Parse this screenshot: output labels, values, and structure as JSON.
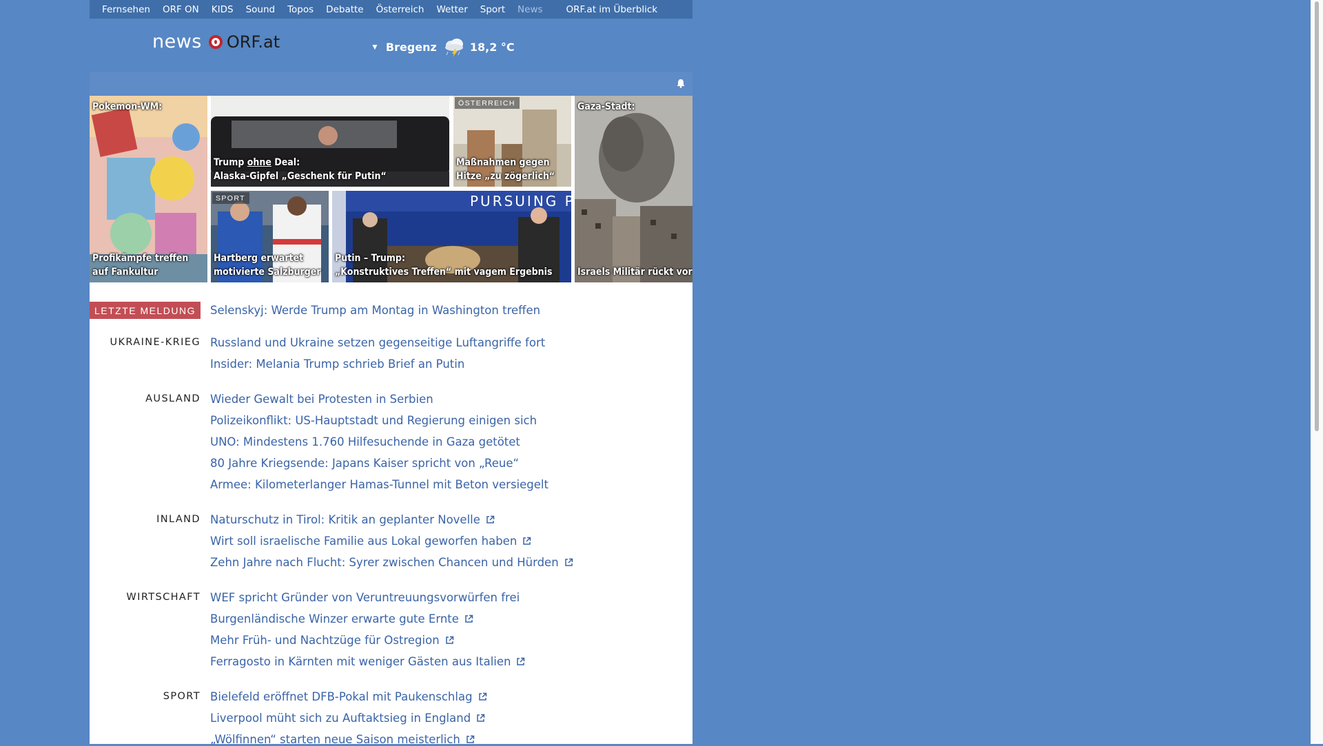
{
  "topnav": {
    "items": [
      "Fernsehen",
      "ORF ON",
      "KIDS",
      "Sound",
      "Topos",
      "Debatte",
      "Österreich",
      "Wetter",
      "Sport",
      "News"
    ],
    "overview": "ORF.at im Überblick"
  },
  "logo": {
    "news": "news",
    "orf": "ORF.at"
  },
  "weather": {
    "city": "Bregenz",
    "temp": "18,2 °C",
    "icon": "rain-cloud-lightning-icon"
  },
  "teasers": {
    "t1": {
      "caption_top": "Pokemon-WM:",
      "caption_bottom": "Profikämpfe treffen auf Fankultur"
    },
    "t2": {
      "title_a": "Trump ",
      "title_b": "ohne",
      "title_c": " Deal:",
      "title_line2": "Alaska-Gipfel „Geschenk für Putin“"
    },
    "t3": {
      "tag": "ÖSTERREICH",
      "title": "Maßnahmen gegen Hitze „zu zögerlich“"
    },
    "t4": {
      "caption_top": "Gaza-Stadt:",
      "caption_bottom": "Israels Militär rückt vor"
    },
    "t5": {
      "tag": "SPORT",
      "title": "Hartberg erwartet motivierte Salzburger"
    },
    "t6": {
      "line1": "Putin – Trump:",
      "line2": "„Konstruktives Treffen“ mit vagem Ergebnis"
    }
  },
  "latest": {
    "badge": "LETZTE MELDUNG",
    "headline": "Selenskyj: Werde Trump am Montag in Washington treffen"
  },
  "sections": [
    {
      "name": "UKRAINE-KRIEG",
      "links": [
        {
          "text": "Russland und Ukraine setzen gegenseitige Luftangriffe fort",
          "ext": false
        },
        {
          "text": "Insider: Melania Trump schrieb Brief an Putin",
          "ext": false
        }
      ]
    },
    {
      "name": "AUSLAND",
      "links": [
        {
          "text": "Wieder Gewalt bei Protesten in Serbien",
          "ext": false
        },
        {
          "text": "Polizeikonflikt: US-Hauptstadt und Regierung einigen sich",
          "ext": false
        },
        {
          "text": "UNO: Mindestens 1.760 Hilfesuchende in Gaza getötet",
          "ext": false
        },
        {
          "text": "80 Jahre Kriegsende: Japans Kaiser spricht von „Reue“",
          "ext": false
        },
        {
          "text": "Armee: Kilometerlanger Hamas-Tunnel mit Beton versiegelt",
          "ext": false
        }
      ]
    },
    {
      "name": "INLAND",
      "links": [
        {
          "text": "Naturschutz in Tirol: Kritik an geplanter Novelle",
          "ext": true
        },
        {
          "text": "Wirt soll israelische Familie aus Lokal geworfen haben",
          "ext": true
        },
        {
          "text": "Zehn Jahre nach Flucht: Syrer zwischen Chancen und Hürden",
          "ext": true
        }
      ]
    },
    {
      "name": "WIRTSCHAFT",
      "links": [
        {
          "text": "WEF spricht Gründer von Veruntreuungsvorwürfen frei",
          "ext": false
        },
        {
          "text": "Burgenländische Winzer erwarte gute Ernte",
          "ext": true
        },
        {
          "text": "Mehr Früh- und Nachtzüge für Ostregion",
          "ext": true
        },
        {
          "text": "Ferragosto in Kärnten mit weniger Gästen aus Italien",
          "ext": true
        }
      ]
    },
    {
      "name": "SPORT",
      "links": [
        {
          "text": "Bielefeld eröffnet DFB-Pokal mit Paukenschlag",
          "ext": true
        },
        {
          "text": "Liverpool müht sich zu Auftaktsieg in England",
          "ext": true
        },
        {
          "text": "„Wölfinnen“ starten neue Saison meisterlich",
          "ext": true
        }
      ]
    }
  ],
  "colors": {
    "page_bg": "#5787c4",
    "nav_bg": "#3f6ea9",
    "link": "#3a64a8",
    "badge": "#c24e55"
  }
}
